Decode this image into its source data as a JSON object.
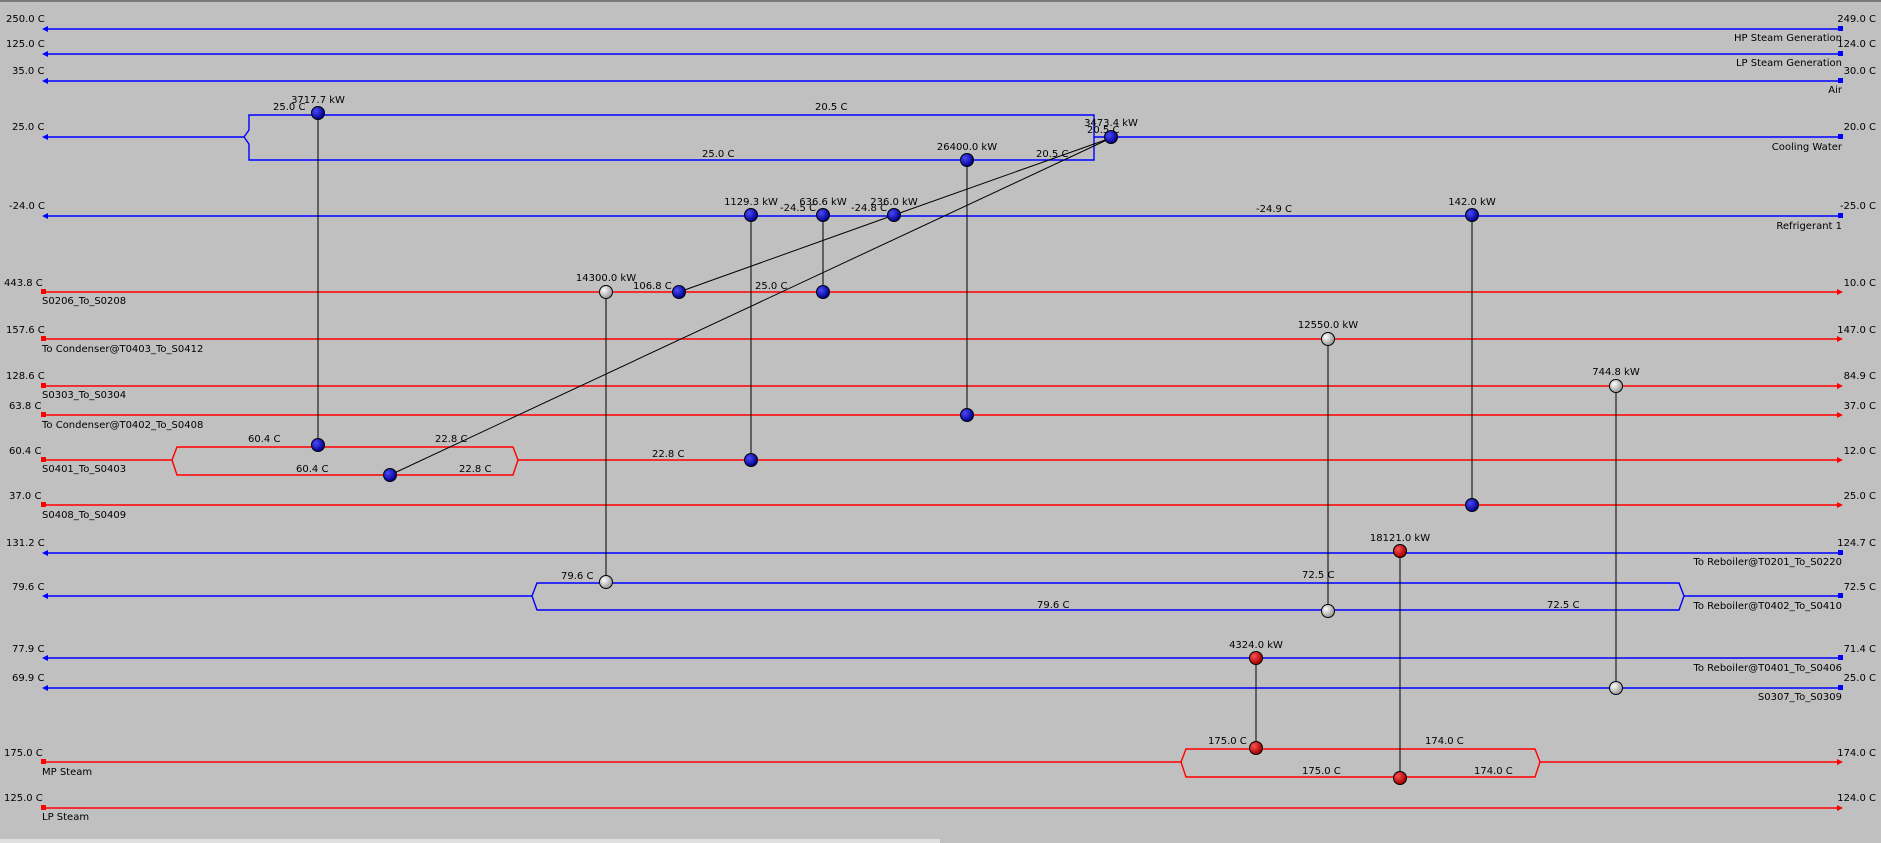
{
  "colors": {
    "background": "#c0c0c0",
    "cold_stream": "#0000ff",
    "hot_stream": "#ff0000",
    "cooler_node": "#0000a0",
    "heater_node": "#c00000",
    "exchanger_node": "#e8e8e8",
    "connector": "#000000"
  },
  "streams": [
    {
      "key": "hp-steam-generation",
      "label": "HP Steam Generation",
      "left_temp": "250.0 C",
      "right_temp": "249.0 C",
      "kind": "cold"
    },
    {
      "key": "lp-steam-generation",
      "label": "LP Steam Generation",
      "left_temp": "125.0 C",
      "right_temp": "124.0 C",
      "kind": "cold"
    },
    {
      "key": "air",
      "label": "Air",
      "left_temp": "35.0 C",
      "right_temp": "30.0 C",
      "kind": "cold"
    },
    {
      "key": "cooling-water",
      "label": "Cooling Water",
      "left_temp": "25.0 C",
      "right_temp": "20.0 C",
      "kind": "cold"
    },
    {
      "key": "refrigerant-1",
      "label": "Refrigerant 1",
      "left_temp": "-24.0 C",
      "right_temp": "-25.0 C",
      "kind": "cold"
    },
    {
      "key": "s0206",
      "label": "S0206_To_S0208",
      "left_temp": "443.8 C",
      "right_temp": "10.0 C",
      "kind": "hot"
    },
    {
      "key": "to-condenser-t0403",
      "label": "To Condenser@T0403_To_S0412",
      "left_temp": "157.6 C",
      "right_temp": "147.0 C",
      "kind": "hot"
    },
    {
      "key": "s0303",
      "label": "S0303_To_S0304",
      "left_temp": "128.6 C",
      "right_temp": "84.9 C",
      "kind": "hot"
    },
    {
      "key": "to-condenser-t0402",
      "label": "To Condenser@T0402_To_S0408",
      "left_temp": "63.8 C",
      "right_temp": "37.0 C",
      "kind": "hot"
    },
    {
      "key": "s0401",
      "label": "S0401_To_S0403",
      "left_temp": "60.4 C",
      "right_temp": "12.0 C",
      "kind": "hot"
    },
    {
      "key": "s0408",
      "label": "S0408_To_S0409",
      "left_temp": "37.0 C",
      "right_temp": "25.0 C",
      "kind": "hot"
    },
    {
      "key": "to-reboiler-t0201",
      "label": "To Reboiler@T0201_To_S0220",
      "left_temp": "131.2 C",
      "right_temp": "124.7 C",
      "kind": "cold"
    },
    {
      "key": "to-reboiler-t0402",
      "label": "To Reboiler@T0402_To_S0410",
      "left_temp": "79.6 C",
      "right_temp": "72.5 C",
      "kind": "cold"
    },
    {
      "key": "to-reboiler-t0401",
      "label": "To Reboiler@T0401_To_S0406",
      "left_temp": "77.9 C",
      "right_temp": "71.4 C",
      "kind": "cold"
    },
    {
      "key": "s0307",
      "label": "S0307_To_S0309",
      "left_temp": "69.9 C",
      "right_temp": "25.0 C",
      "kind": "cold"
    },
    {
      "key": "mp-steam",
      "label": "MP Steam",
      "left_temp": "175.0 C",
      "right_temp": "174.0 C",
      "kind": "hot"
    },
    {
      "key": "lp-steam",
      "label": "LP Steam",
      "left_temp": "125.0 C",
      "right_temp": "124.0 C",
      "kind": "hot"
    }
  ],
  "exchangers": [
    {
      "key": "e-3717",
      "duty": "3717.7 kW",
      "type": "cooler"
    },
    {
      "key": "e-3473",
      "duty": "3473.4 kW",
      "type": "cooler"
    },
    {
      "key": "e-26400",
      "duty": "26400.0 kW",
      "type": "cooler"
    },
    {
      "key": "e-1129",
      "duty": "1129.3 kW",
      "type": "cooler"
    },
    {
      "key": "e-636",
      "duty": "636.6 kW",
      "type": "cooler"
    },
    {
      "key": "e-236",
      "duty": "236.0 kW",
      "type": "cooler"
    },
    {
      "key": "e-142",
      "duty": "142.0 kW",
      "type": "cooler"
    },
    {
      "key": "e-14300",
      "duty": "14300.0 kW",
      "type": "exchanger"
    },
    {
      "key": "e-12550",
      "duty": "12550.0 kW",
      "type": "exchanger"
    },
    {
      "key": "e-744",
      "duty": "744.8 kW",
      "type": "exchanger"
    },
    {
      "key": "e-18121",
      "duty": "18121.0 kW",
      "type": "heater"
    },
    {
      "key": "e-4324",
      "duty": "4324.0 kW",
      "type": "heater"
    }
  ],
  "temps": [
    {
      "key": "cw-split-top-left",
      "text": "25.0 C"
    },
    {
      "key": "cw-split-top-mid",
      "text": "20.5 C"
    },
    {
      "key": "cw-split-bot-mid",
      "text": "25.0 C"
    },
    {
      "key": "cw-split-bot-right",
      "text": "20.5 C"
    },
    {
      "key": "cw-outlet",
      "text": "20.5 C"
    },
    {
      "key": "ref-t1",
      "text": "-24.5 C"
    },
    {
      "key": "ref-t2",
      "text": "-24.8 C"
    },
    {
      "key": "ref-t3",
      "text": "-24.9 C"
    },
    {
      "key": "s0206-t1",
      "text": "106.8 C"
    },
    {
      "key": "s0206-t2",
      "text": "25.0 C"
    },
    {
      "key": "s0401-split-tl",
      "text": "60.4 C"
    },
    {
      "key": "s0401-split-tr",
      "text": "22.8 C"
    },
    {
      "key": "s0401-split-bl",
      "text": "60.4 C"
    },
    {
      "key": "s0401-split-br",
      "text": "22.8 C"
    },
    {
      "key": "s0401-mid",
      "text": "22.8 C"
    },
    {
      "key": "rb2-split-tl",
      "text": "79.6 C"
    },
    {
      "key": "rb2-split-tm",
      "text": "72.5 C"
    },
    {
      "key": "rb2-split-bm",
      "text": "79.6 C"
    },
    {
      "key": "rb2-split-br",
      "text": "72.5 C"
    },
    {
      "key": "mp-split-tl",
      "text": "175.0 C"
    },
    {
      "key": "mp-split-tr",
      "text": "174.0 C"
    },
    {
      "key": "mp-split-bl",
      "text": "175.0 C"
    },
    {
      "key": "mp-split-br",
      "text": "174.0 C"
    }
  ]
}
